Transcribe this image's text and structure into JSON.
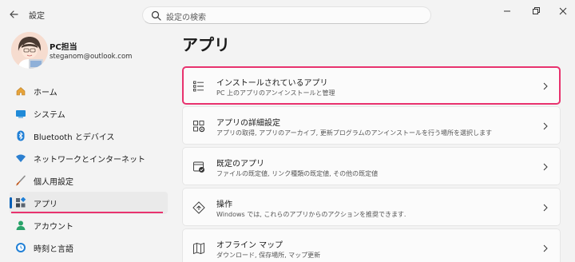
{
  "window": {
    "title": "設定",
    "controls": [
      "minimize-icon",
      "restore-icon",
      "close-icon"
    ]
  },
  "search": {
    "placeholder": "設定の検索"
  },
  "profile": {
    "name": "PC担当",
    "email": "steganom@outlook.com"
  },
  "sidebar": {
    "items": [
      {
        "label": "ホーム",
        "icon": "home-icon"
      },
      {
        "label": "システム",
        "icon": "system-icon"
      },
      {
        "label": "Bluetooth とデバイス",
        "icon": "bluetooth-icon"
      },
      {
        "label": "ネットワークとインターネット",
        "icon": "wifi-icon"
      },
      {
        "label": "個人用設定",
        "icon": "brush-icon"
      },
      {
        "label": "アプリ",
        "icon": "apps-icon",
        "active": true
      },
      {
        "label": "アカウント",
        "icon": "account-icon"
      },
      {
        "label": "時刻と言語",
        "icon": "time-language-icon"
      }
    ]
  },
  "main": {
    "title": "アプリ",
    "cards": [
      {
        "title": "インストールされているアプリ",
        "subtitle": "PC 上のアプリのアンインストールと管理",
        "icon": "list-icon",
        "highlighted": true
      },
      {
        "title": "アプリの詳細設定",
        "subtitle": "アプリの取得, アプリのアーカイブ, 更新プログラムのアンインストールを行う場所を選択します",
        "icon": "advanced-apps-icon"
      },
      {
        "title": "既定のアプリ",
        "subtitle": "ファイルの既定値, リンク種類の既定値, その他の既定値",
        "icon": "default-apps-icon"
      },
      {
        "title": "操作",
        "subtitle": "Windows では, これらのアプリからのアクションを推奨できます.",
        "icon": "actions-icon"
      },
      {
        "title": "オフライン マップ",
        "subtitle": "ダウンロード, 保存場所, マップ更新",
        "icon": "map-icon"
      }
    ]
  },
  "colors": {
    "accent": "#005fb8",
    "highlight": "#e8326e",
    "background": "#f3f3f3",
    "card": "#fbfbfb"
  }
}
